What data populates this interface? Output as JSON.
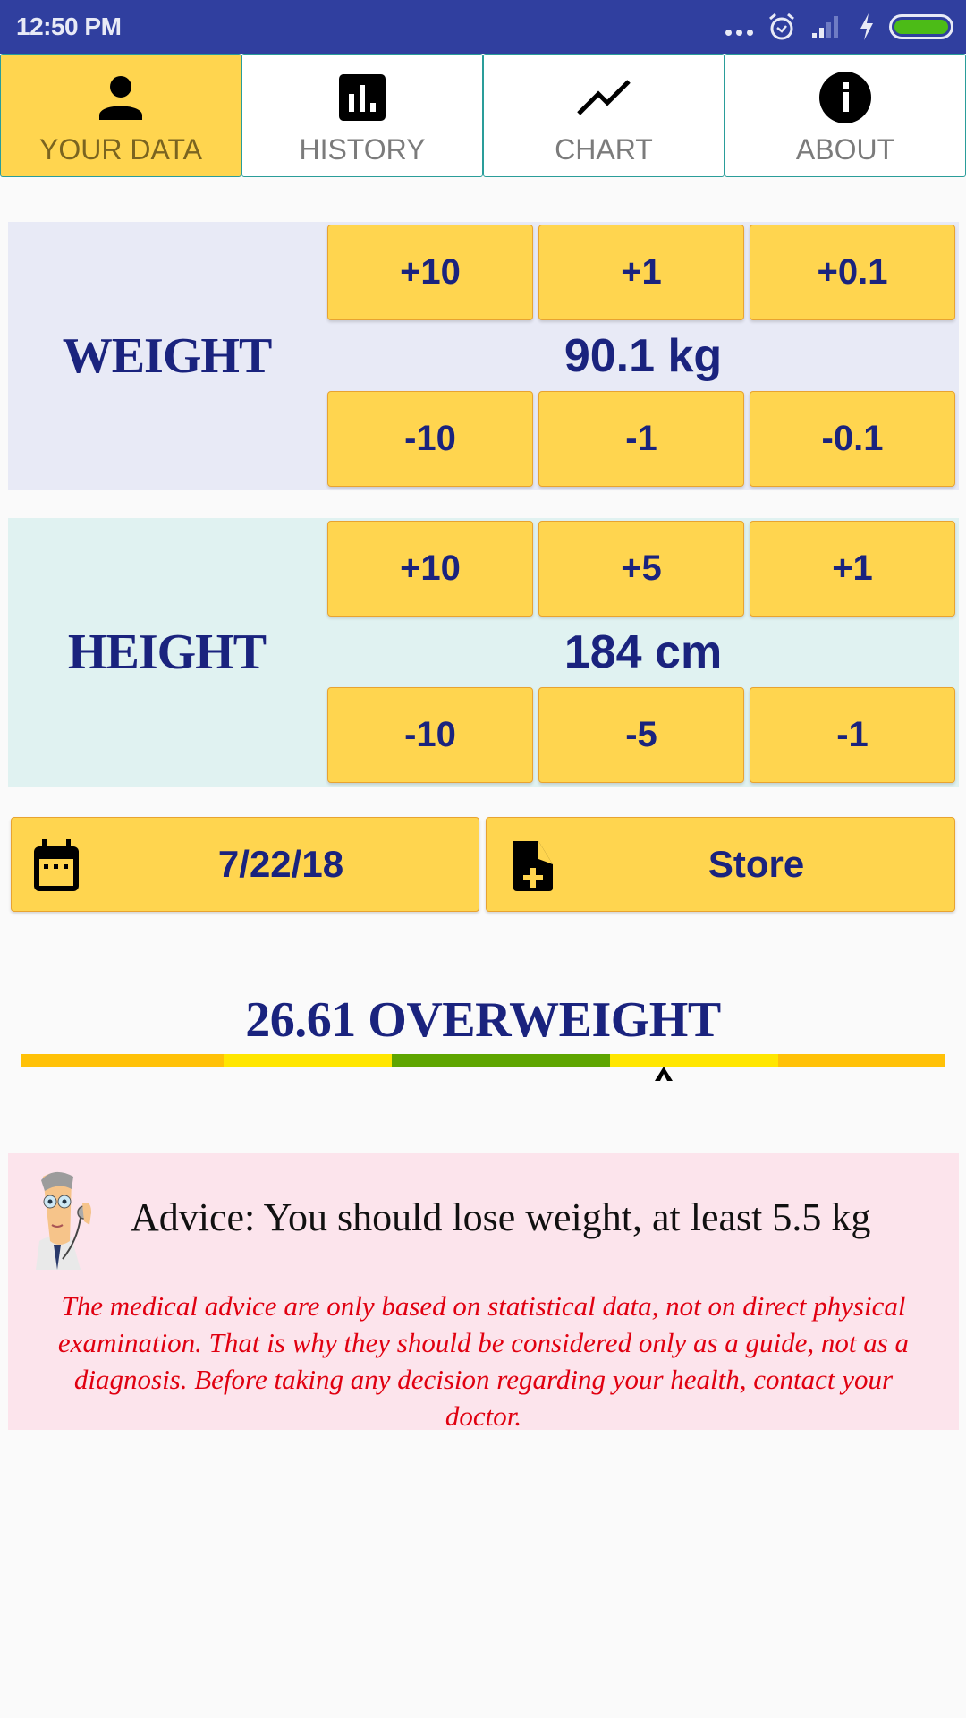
{
  "status_bar": {
    "time": "12:50 PM",
    "icons": [
      "more-dots-icon",
      "alarm-icon",
      "signal-icon",
      "charging-icon",
      "battery-icon"
    ],
    "battery_color": "#4cbb17"
  },
  "tabs": [
    {
      "label": "YOUR DATA",
      "icon": "person-icon",
      "active": true
    },
    {
      "label": "HISTORY",
      "icon": "bar-chart-icon",
      "active": false
    },
    {
      "label": "CHART",
      "icon": "line-chart-icon",
      "active": false
    },
    {
      "label": "ABOUT",
      "icon": "info-icon",
      "active": false
    }
  ],
  "weight": {
    "label": "WEIGHT",
    "value": "90.1 kg",
    "increment_buttons": [
      "+10",
      "+1",
      "+0.1"
    ],
    "decrement_buttons": [
      "-10",
      "-1",
      "-0.1"
    ]
  },
  "height": {
    "label": "HEIGHT",
    "value": "184 cm",
    "increment_buttons": [
      "+10",
      "+5",
      "+1"
    ],
    "decrement_buttons": [
      "-10",
      "-5",
      "-1"
    ]
  },
  "actions": {
    "date_label": "7/22/18",
    "store_label": "Store"
  },
  "bmi": {
    "text": "26.61 OVERWEIGHT",
    "value": 26.61,
    "category": "OVERWEIGHT",
    "scale_segments": [
      {
        "color": "#ffc107",
        "fraction": 0.219
      },
      {
        "color": "#ffe600",
        "fraction": 0.182
      },
      {
        "color": "#5ea500",
        "fraction": 0.236
      },
      {
        "color": "#ffe600",
        "fraction": 0.182
      },
      {
        "color": "#ffc107",
        "fraction": 0.181
      }
    ],
    "marker_position_fraction": 0.695
  },
  "advice": {
    "text": "Advice: You should lose weight, at least 5.5 kg",
    "disclaimer": "The medical advice are only based on statistical data, not on direct physical examination. That is why they should be considered only as a guide, not as a diagnosis. Before taking any decision regarding your health, contact your doctor."
  },
  "colors": {
    "primary": "#303f9f",
    "accent_yellow": "#ffd54f",
    "text_navy": "#1a237e",
    "disclaimer_red": "#e00010"
  }
}
